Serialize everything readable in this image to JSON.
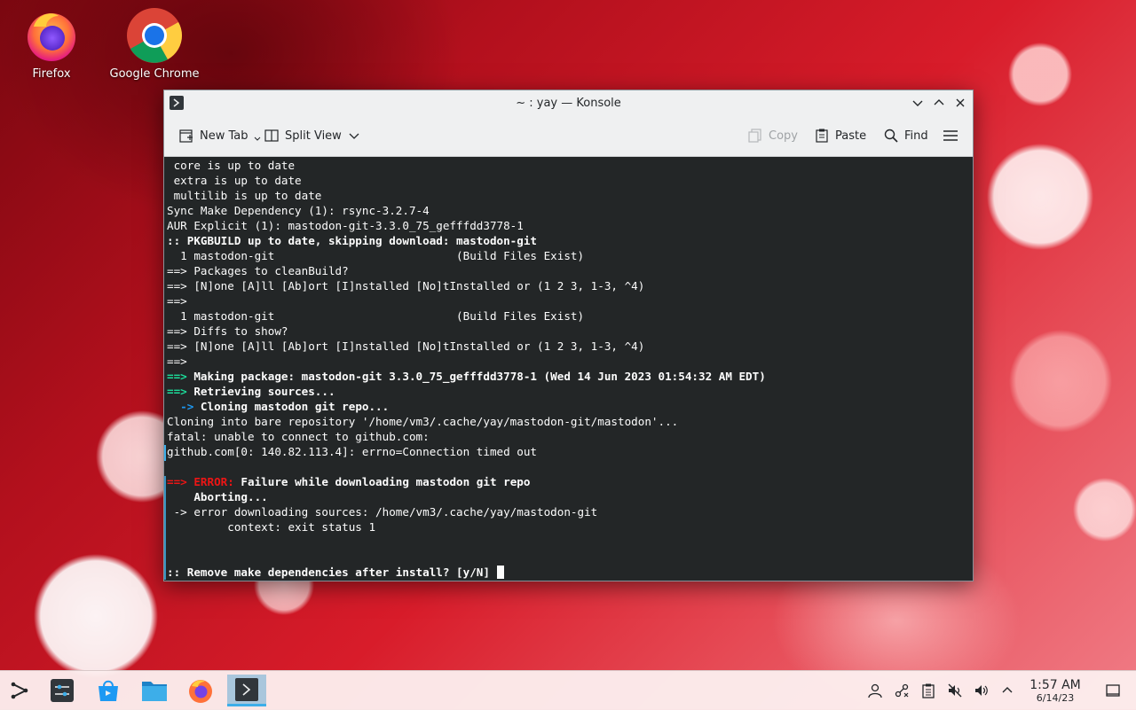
{
  "desktop": {
    "icons": [
      {
        "label": "Firefox",
        "icon": "firefox-icon"
      },
      {
        "label": "Google Chrome",
        "icon": "chrome-icon"
      }
    ]
  },
  "window": {
    "title": "~ : yay — Konsole",
    "toolbar": {
      "new_tab": "New Tab",
      "split_view": "Split View",
      "copy": "Copy",
      "paste": "Paste",
      "find": "Find"
    }
  },
  "terminal": {
    "lines": [
      " core is up to date",
      " extra is up to date",
      " multilib is up to date",
      "Sync Make Dependency (1): rsync-3.2.7-4",
      "AUR Explicit (1): mastodon-git-3.3.0_75_gefffdd3778-1",
      ":: PKGBUILD up to date, skipping download: mastodon-git",
      "  1 mastodon-git                           (Build Files Exist)",
      "==> Packages to cleanBuild?",
      "==> [N]one [A]ll [Ab]ort [I]nstalled [No]tInstalled or (1 2 3, 1-3, ^4)",
      "==>",
      "  1 mastodon-git                           (Build Files Exist)",
      "==> Diffs to show?",
      "==> [N]one [A]ll [Ab]ort [I]nstalled [No]tInstalled or (1 2 3, 1-3, ^4)",
      "==>",
      "==> Making package: mastodon-git 3.3.0_75_gefffdd3778-1 (Wed 14 Jun 2023 01:54:32 AM EDT)",
      "==> Retrieving sources...",
      "  -> Cloning mastodon git repo...",
      "Cloning into bare repository '/home/vm3/.cache/yay/mastodon-git/mastodon'...",
      "fatal: unable to connect to github.com:",
      "github.com[0: 140.82.113.4]: errno=Connection timed out",
      "",
      "==> ERROR: Failure while downloading mastodon git repo",
      "    Aborting...",
      " -> error downloading sources: /home/vm3/.cache/yay/mastodon-git",
      "         context: exit status 1",
      "",
      "",
      ":: Remove make dependencies after install? [y/N] "
    ]
  },
  "taskbar": {
    "clock_time": "1:57 AM",
    "clock_date": "6/14/23"
  },
  "colors": {
    "terminal_bg": "#232627",
    "terminal_fg": "#fcfcfc",
    "arrow_green": "#1cdc9a",
    "arrow_blue": "#1d99f3",
    "error_red": "#ed1515",
    "accent": "#3daee9"
  }
}
